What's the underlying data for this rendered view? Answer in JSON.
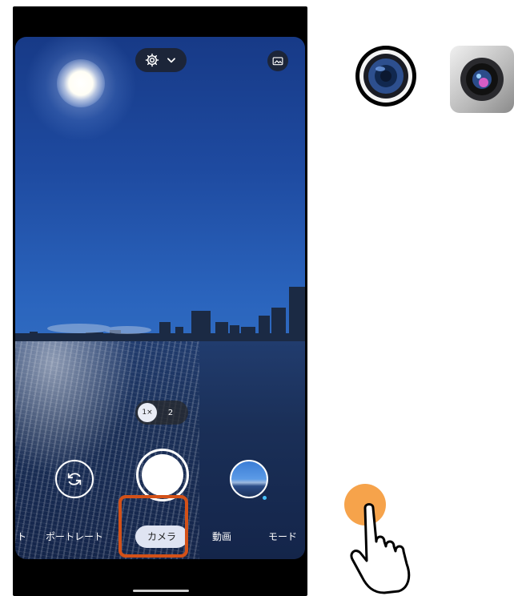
{
  "camera_app": {
    "top_bar": {
      "settings_icon": "gear-icon",
      "dropdown_icon": "chevron-down-icon",
      "gallery_icon": "folder-image-icon"
    },
    "zoom": {
      "active": "1×",
      "other": "2"
    },
    "controls": {
      "flip_icon": "camera-flip-icon",
      "shutter_icon": "shutter-icon",
      "thumbnail_icon": "last-photo-thumbnail"
    },
    "modes": {
      "left_partial": "ト",
      "portrait": "ポートレート",
      "camera": "カメラ",
      "video": "動画",
      "more": "モード"
    }
  },
  "annotation": {
    "highlight_color": "#d35118",
    "tap_color": "#f6a34b"
  },
  "app_icons": [
    "camera-app-icon-round",
    "camera-app-icon-square"
  ]
}
